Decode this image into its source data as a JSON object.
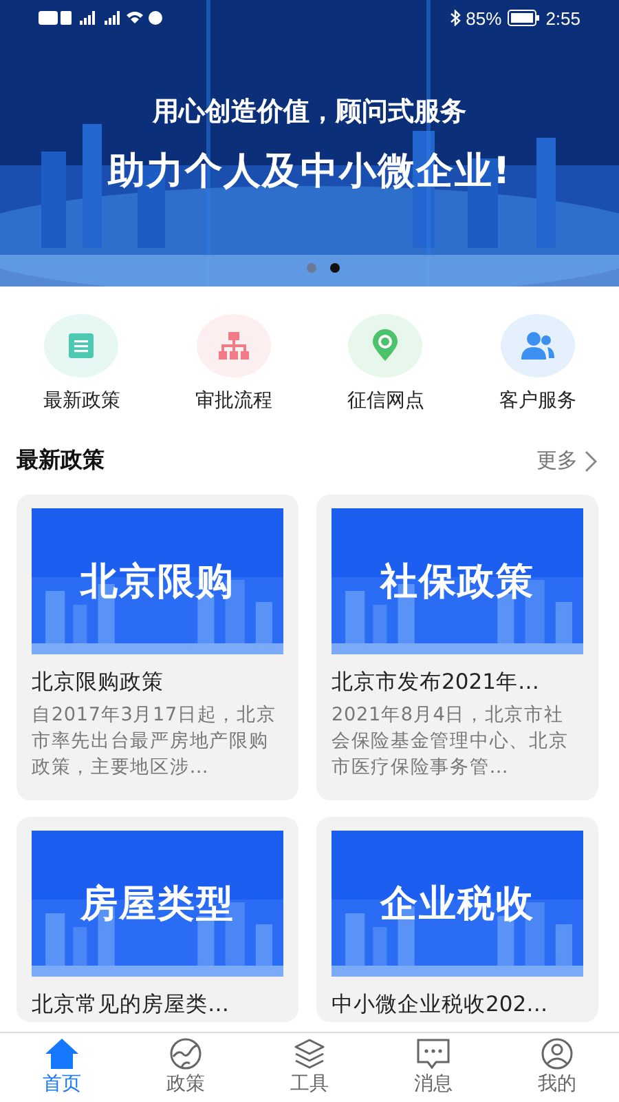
{
  "status_bar": {
    "battery": "85%",
    "time": "2:55"
  },
  "banner": {
    "kind": "picture",
    "slogan": "用心创造价值，顾问式服务",
    "headline": "助力个人及中小微企业!",
    "dots": [
      {
        "selected": false
      },
      {
        "selected": true
      }
    ]
  },
  "shortcuts": [
    {
      "label": "最新政策",
      "kind": "document",
      "color": "#4cc9b0"
    },
    {
      "label": "审批流程",
      "kind": "flowchart",
      "color": "#f27c86"
    },
    {
      "label": "征信网点",
      "kind": "location",
      "color": "#4cc26a"
    },
    {
      "label": "客户服务",
      "kind": "users",
      "color": "#3d8ff0"
    }
  ],
  "section": {
    "title": "最新政策",
    "more": "更多"
  },
  "articles": [
    {
      "image_text": "北京限购",
      "title": "北京限购政策",
      "summary": "自2017年3月17日起，北京市率先出台最严房地产限购政策，主要地区涉…"
    },
    {
      "image_text": "社保政策",
      "title": "北京市发布2021年…",
      "summary": "2021年8月4日，北京市社会保险基金管理中心、北京市医疗保险事务管…"
    },
    {
      "image_text": "房屋类型",
      "title": "北京常见的房屋类…"
    },
    {
      "image_text": "企业税收",
      "title": "中小微企业税收202…"
    }
  ],
  "tabs": [
    {
      "label": "首页",
      "kind": "home",
      "selected": true
    },
    {
      "label": "政策",
      "kind": "globe",
      "selected": false
    },
    {
      "label": "工具",
      "kind": "layers",
      "selected": false
    },
    {
      "label": "消息",
      "kind": "message",
      "selected": false
    },
    {
      "label": "我的",
      "kind": "profile",
      "selected": false
    }
  ]
}
